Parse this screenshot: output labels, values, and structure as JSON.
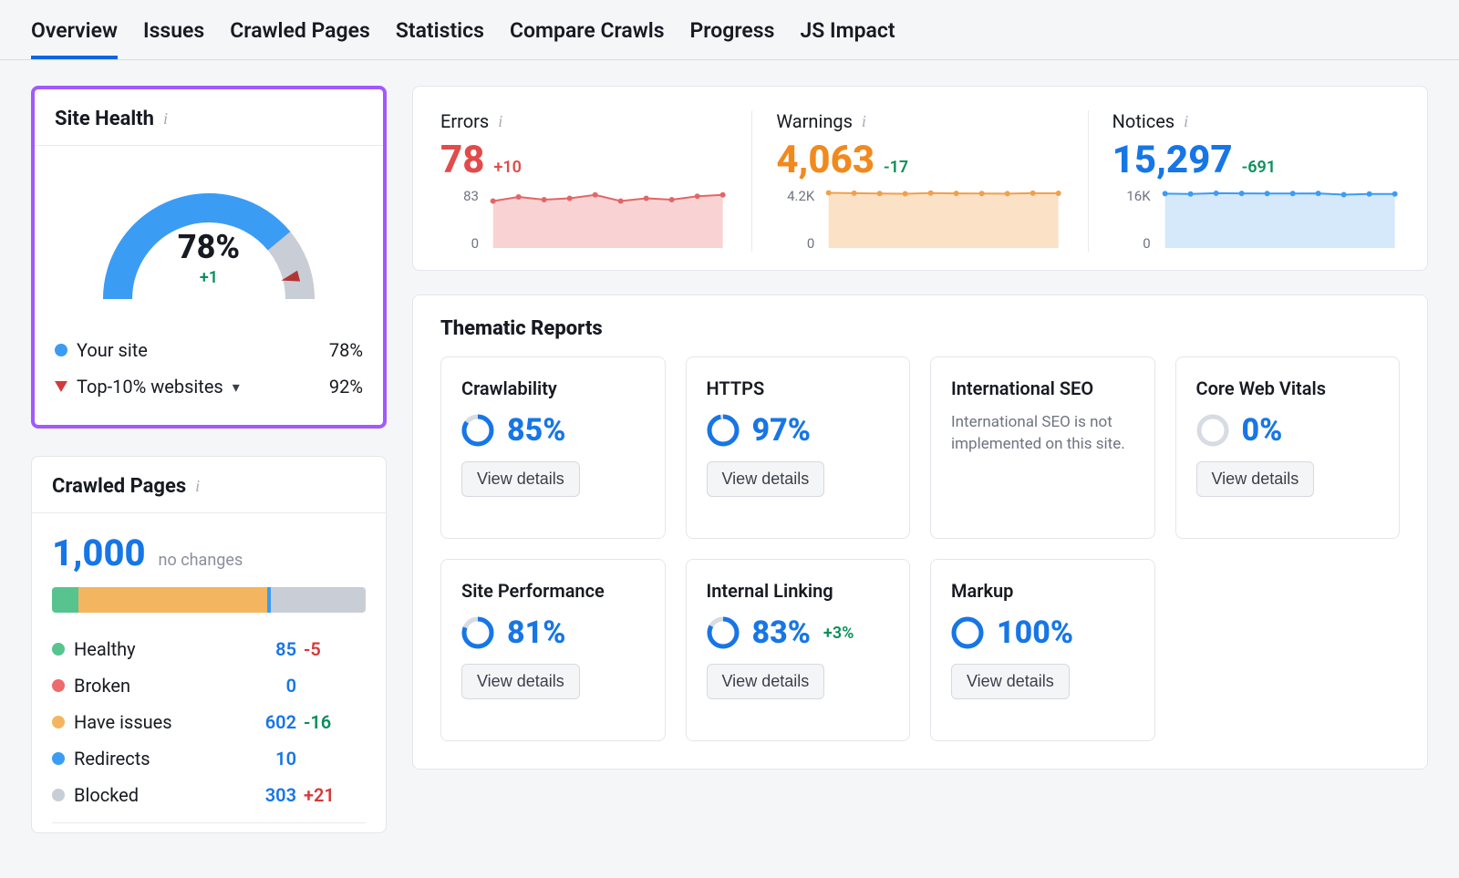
{
  "tabs": [
    "Overview",
    "Issues",
    "Crawled Pages",
    "Statistics",
    "Compare Crawls",
    "Progress",
    "JS Impact"
  ],
  "active_tab": 0,
  "site_health": {
    "title": "Site Health",
    "percent": "78%",
    "percent_num": 78,
    "delta": "+1",
    "rows": [
      {
        "label": "Your site",
        "value": "78%"
      },
      {
        "label": "Top-10% websites",
        "value": "92%",
        "top10_num": 92
      }
    ]
  },
  "crawled_pages": {
    "title": "Crawled Pages",
    "count": "1,000",
    "sub": "no changes",
    "breakdown": [
      {
        "label": "Healthy",
        "value": "85",
        "delta": "-5",
        "delta_class": "d-red",
        "dot": "dot-green",
        "pct": 8.5
      },
      {
        "label": "Broken",
        "value": "0",
        "delta": "",
        "delta_class": "",
        "dot": "dot-red",
        "pct": 0
      },
      {
        "label": "Have issues",
        "value": "602",
        "delta": "-16",
        "delta_class": "d-green",
        "dot": "dot-orange",
        "pct": 60.2
      },
      {
        "label": "Redirects",
        "value": "10",
        "delta": "",
        "delta_class": "",
        "dot": "dot-blue",
        "pct": 1.0
      },
      {
        "label": "Blocked",
        "value": "303",
        "delta": "+21",
        "delta_class": "d-red",
        "dot": "dot-grey",
        "pct": 30.3
      }
    ]
  },
  "metrics": {
    "errors": {
      "label": "Errors",
      "value": "78",
      "delta": "+10",
      "delta_class": "c-red",
      "val_class": "c-red",
      "axis_top": "83",
      "axis_bot": "0",
      "fill": "#f9d3d3",
      "stroke": "#e36666"
    },
    "warnings": {
      "label": "Warnings",
      "value": "4,063",
      "delta": "-17",
      "delta_class": "c-green",
      "val_class": "c-orange",
      "axis_top": "4.2K",
      "axis_bot": "0",
      "fill": "#fbe2c6",
      "stroke": "#f0a04d"
    },
    "notices": {
      "label": "Notices",
      "value": "15,297",
      "delta": "-691",
      "delta_class": "c-green",
      "val_class": "c-blue",
      "axis_top": "16K",
      "axis_bot": "0",
      "fill": "#d6e9fb",
      "stroke": "#3b9cf4"
    }
  },
  "chart_data": [
    {
      "type": "line",
      "title": "Errors",
      "ylabel": "",
      "xlabel": "",
      "ylim": [
        0,
        83
      ],
      "x": [
        1,
        2,
        3,
        4,
        5,
        6,
        7,
        8,
        9,
        10
      ],
      "values": [
        69,
        75,
        71,
        73,
        78,
        69,
        73,
        71,
        76,
        78
      ]
    },
    {
      "type": "line",
      "title": "Warnings",
      "ylabel": "",
      "xlabel": "",
      "ylim": [
        0,
        4200
      ],
      "x": [
        1,
        2,
        3,
        4,
        5,
        6,
        7,
        8,
        9,
        10
      ],
      "values": [
        4100,
        4070,
        4050,
        4030,
        4080,
        4060,
        4050,
        4040,
        4070,
        4063
      ]
    },
    {
      "type": "line",
      "title": "Notices",
      "ylabel": "",
      "xlabel": "",
      "ylim": [
        0,
        16000
      ],
      "x": [
        1,
        2,
        3,
        4,
        5,
        6,
        7,
        8,
        9,
        10
      ],
      "values": [
        15400,
        15300,
        15500,
        15450,
        15420,
        15430,
        15440,
        15100,
        15300,
        15297
      ]
    }
  ],
  "thematic": {
    "title": "Thematic Reports",
    "button": "View details",
    "cards": [
      {
        "title": "Crawlability",
        "pct": "85%",
        "pct_num": 85,
        "btn": true
      },
      {
        "title": "HTTPS",
        "pct": "97%",
        "pct_num": 97,
        "btn": true
      },
      {
        "title": "International SEO",
        "note": "International SEO is not implemented on this site."
      },
      {
        "title": "Core Web Vitals",
        "pct": "0%",
        "pct_num": 0,
        "btn": true
      },
      {
        "title": "Site Performance",
        "pct": "81%",
        "pct_num": 81,
        "btn": true
      },
      {
        "title": "Internal Linking",
        "pct": "83%",
        "pct_num": 83,
        "btn": true,
        "delta": "+3%"
      },
      {
        "title": "Markup",
        "pct": "100%",
        "pct_num": 100,
        "btn": true
      }
    ]
  }
}
